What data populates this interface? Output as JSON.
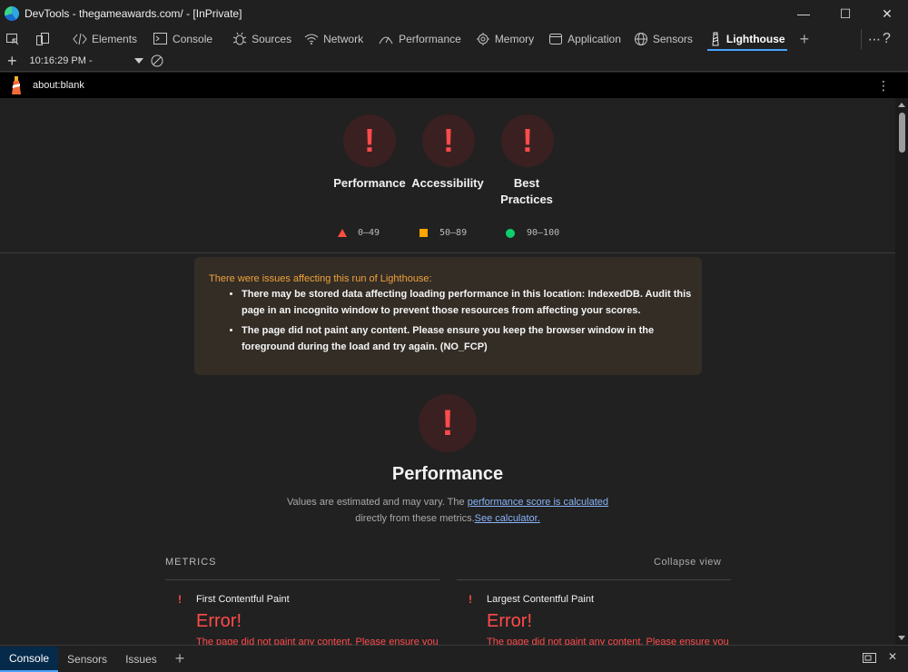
{
  "window": {
    "title": "DevTools - thegameawards.com/ - [InPrivate]",
    "controls": [
      "minimize",
      "maximize",
      "close"
    ]
  },
  "tabs": [
    {
      "label": "Elements",
      "icon": "code-icon"
    },
    {
      "label": "Console",
      "icon": "console-icon"
    },
    {
      "label": "Sources",
      "icon": "bug-icon"
    },
    {
      "label": "Network",
      "icon": "wifi-icon"
    },
    {
      "label": "Performance",
      "icon": "performance-icon"
    },
    {
      "label": "Memory",
      "icon": "memory-icon"
    },
    {
      "label": "Application",
      "icon": "application-icon"
    },
    {
      "label": "Sensors",
      "icon": "globe-icon"
    },
    {
      "label": "Lighthouse",
      "icon": "lighthouse-icon",
      "active": true
    }
  ],
  "subbar": {
    "report_time": "10:16:29 PM -"
  },
  "urlbar": {
    "url": "about:blank"
  },
  "gauges": [
    {
      "label": "Performance",
      "symbol": "!"
    },
    {
      "label": "Accessibility",
      "symbol": "!"
    },
    {
      "label": "Best Practices",
      "symbol": "!"
    }
  ],
  "legend": {
    "fail": "0–49",
    "average": "50–89",
    "pass": "90–100",
    "colors": {
      "fail": "#ff4e42",
      "average": "#ffa400",
      "pass": "#0cce6b"
    }
  },
  "warnings": {
    "heading": "There were issues affecting this run of Lighthouse:",
    "items": [
      "There may be stored data affecting loading performance in this location: IndexedDB. Audit this page in an incognito window to prevent those resources from affecting your scores.",
      "The page did not paint any content. Please ensure you keep the browser window in the foreground during the load and try again. (NO_FCP)"
    ]
  },
  "performance": {
    "symbol": "!",
    "title": "Performance",
    "desc_prefix": "Values are estimated and may vary. The ",
    "desc_link": "performance score is calculated",
    "desc_mid": "directly from these metrics.",
    "desc_link2": "See calculator."
  },
  "metrics": {
    "heading": "METRICS",
    "collapse": "Collapse view",
    "items": [
      {
        "name": "First Contentful Paint",
        "value": "Error!",
        "message": "The page did not paint any content. Please ensure you"
      },
      {
        "name": "Largest Contentful Paint",
        "value": "Error!",
        "message": "The page did not paint any content. Please ensure you"
      }
    ]
  },
  "drawer": {
    "tabs": [
      "Console",
      "Sensors",
      "Issues"
    ]
  },
  "colors": {
    "accent": "#4aa3ff",
    "error": "#ff4b4b",
    "warning": "#f2a23a"
  }
}
